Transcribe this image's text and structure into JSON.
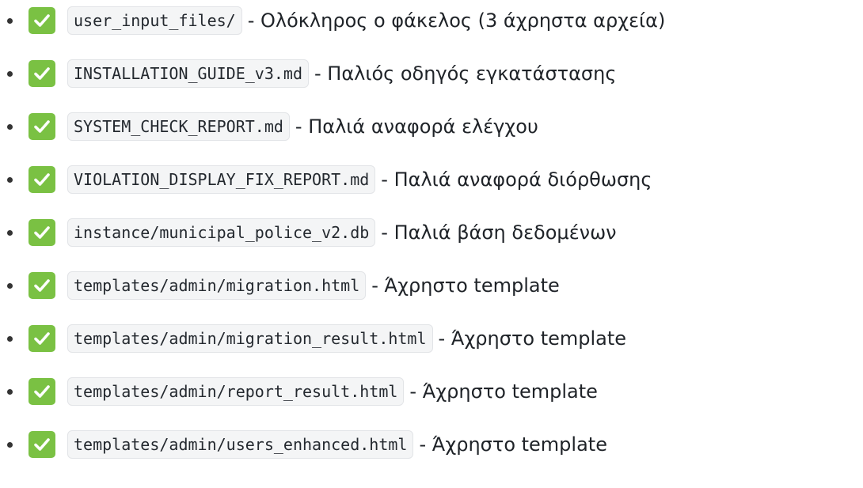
{
  "items": [
    {
      "path": "user_input_files/",
      "description": "- Ολόκληρος ο φάκελος (3 άχρηστα αρχεία)"
    },
    {
      "path": "INSTALLATION_GUIDE_v3.md",
      "description": "- Παλιός οδηγός εγκατάστασης"
    },
    {
      "path": "SYSTEM_CHECK_REPORT.md",
      "description": "- Παλιά αναφορά ελέγχου"
    },
    {
      "path": "VIOLATION_DISPLAY_FIX_REPORT.md",
      "description": "- Παλιά αναφορά διόρθωσης"
    },
    {
      "path": "instance/municipal_police_v2.db",
      "description": "- Παλιά βάση δεδομένων"
    },
    {
      "path": "templates/admin/migration.html",
      "description": "- Άχρηστο template"
    },
    {
      "path": "templates/admin/migration_result.html",
      "description": "- Άχρηστο template"
    },
    {
      "path": "templates/admin/report_result.html",
      "description": "- Άχρηστο template"
    },
    {
      "path": "templates/admin/users_enhanced.html",
      "description": "- Άχρηστο template"
    }
  ],
  "icons": {
    "bullet": "bullet-dot",
    "status": "check-mark-button-icon"
  },
  "colors": {
    "check_background": "#7ac143",
    "code_background": "#f4f5f6",
    "text": "#1f2328"
  }
}
